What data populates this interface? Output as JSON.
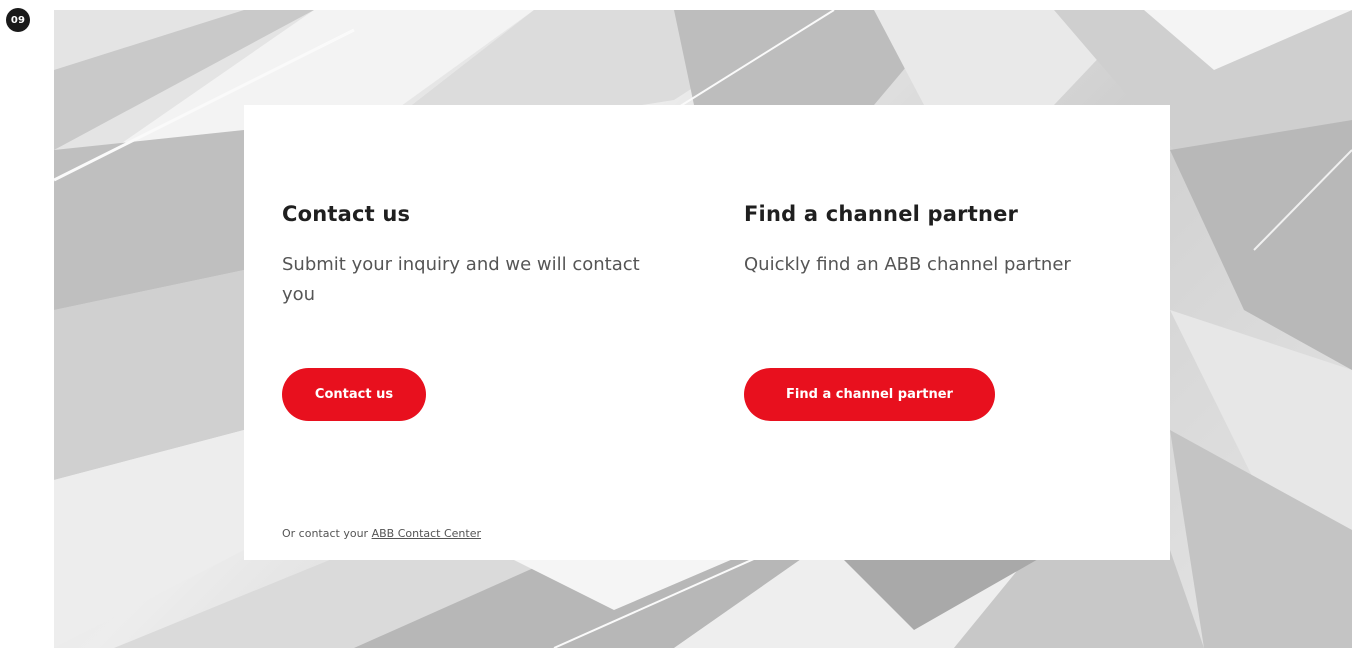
{
  "badge": {
    "label": "09"
  },
  "card": {
    "left": {
      "heading": "Contact us",
      "description": "Submit your inquiry and we will contact you",
      "button_label": "Contact us"
    },
    "right": {
      "heading": "Find a channel partner",
      "description": "Quickly find an ABB channel partner",
      "button_label": "Find a channel partner"
    },
    "footer": {
      "prefix": "Or contact your ",
      "link_text": "ABB Contact Center"
    }
  },
  "colors": {
    "accent": "#e8101e",
    "heading": "#1f1f1f",
    "body_text": "#555555",
    "badge_bg": "#1a1a1a"
  }
}
